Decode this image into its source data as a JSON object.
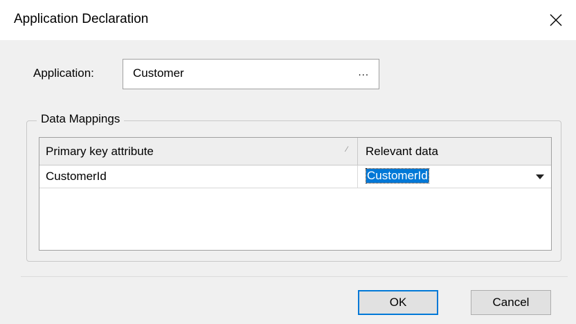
{
  "window": {
    "title": "Application Declaration",
    "close_glyph": "×"
  },
  "application": {
    "label": "Application:",
    "value": "Customer",
    "browse_label": "..."
  },
  "data_mappings": {
    "legend": "Data Mappings",
    "columns": [
      {
        "header": "Primary key attribute",
        "sort_indicator": "∕"
      },
      {
        "header": "Relevant data"
      }
    ],
    "rows": [
      {
        "primary_key": "CustomerId",
        "relevant_data": "CustomerId"
      }
    ]
  },
  "buttons": {
    "ok_label": "OK",
    "cancel_label": "Cancel"
  },
  "colors": {
    "selection": "#0078d7",
    "client_bg": "#f0f0f0",
    "default_button_border": "#0078d7"
  }
}
